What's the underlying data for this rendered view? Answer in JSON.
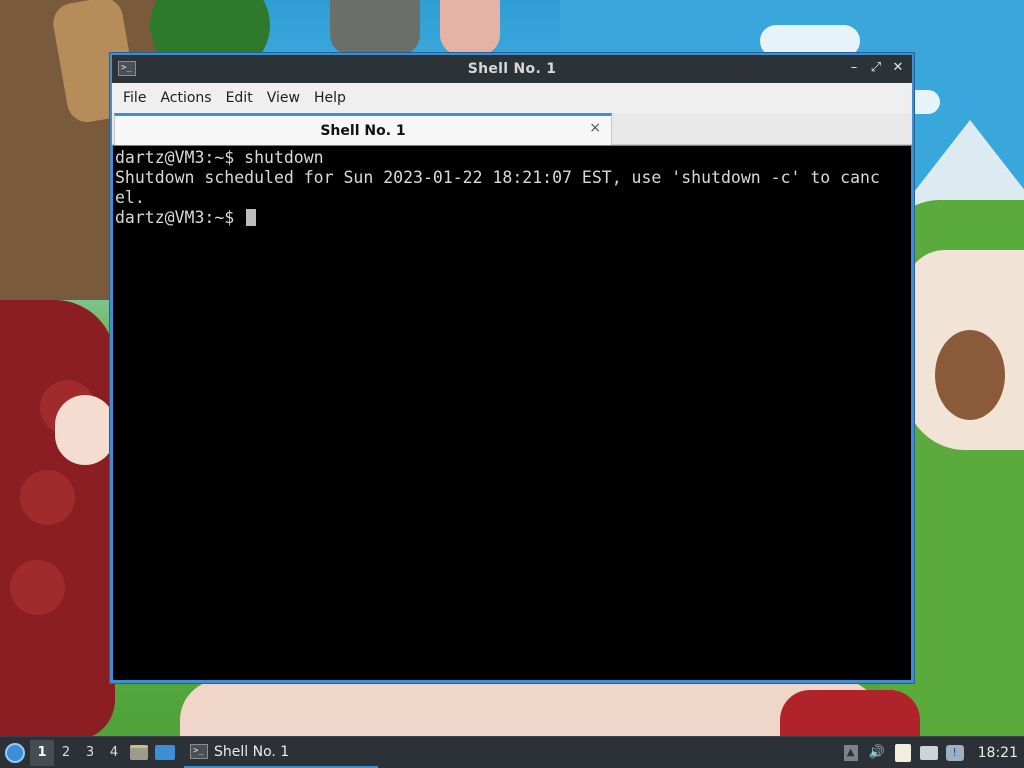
{
  "window": {
    "title": "Shell No. 1",
    "controls": {
      "minimize": "–",
      "restore": "⤢",
      "close": "✕"
    }
  },
  "menubar": {
    "items": [
      "File",
      "Actions",
      "Edit",
      "View",
      "Help"
    ]
  },
  "tabs": [
    {
      "label": "Shell No. 1",
      "close": "×"
    }
  ],
  "terminal": {
    "lines": [
      "dartz@VM3:~$ shutdown",
      "Shutdown scheduled for Sun 2023-01-22 18:21:07 EST, use 'shutdown -c' to canc",
      "el.",
      "dartz@VM3:~$ "
    ]
  },
  "taskbar": {
    "workspaces": [
      "1",
      "2",
      "3",
      "4"
    ],
    "active_workspace": "1",
    "task_button": {
      "label": "Shell No. 1",
      "icon": "terminal-icon"
    },
    "tray_icons": [
      "tray-expand-icon",
      "volume-icon",
      "clipboard-icon",
      "network-icon",
      "update-notifier-icon"
    ],
    "clock": "18:21"
  },
  "colors": {
    "accent": "#3b8ed8",
    "titlebar": "#2d3237",
    "terminal_bg": "#000000",
    "terminal_fg": "#d9d9d9"
  }
}
